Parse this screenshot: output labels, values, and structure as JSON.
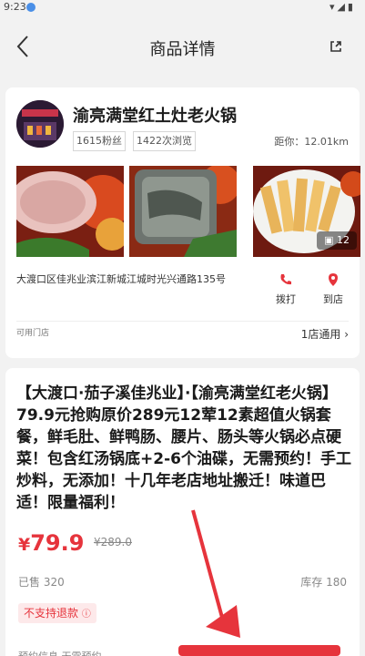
{
  "status_bar": {
    "time": "9:23",
    "right_icons": "▾◢▮"
  },
  "header": {
    "title": "商品详情"
  },
  "store": {
    "name": "渝亮满堂红土灶老火锅",
    "fans": "1615粉丝",
    "views": "1422次浏览",
    "distance": "距你：12.01km",
    "photo_count": "12",
    "address": "大渡口区佳兆业滨江新城江城时光兴通路135号",
    "call_label": "拨打",
    "go_label": "到店",
    "usable_label": "可用门店",
    "stores_link": "1店通用"
  },
  "product": {
    "title": "【大渡口·茄子溪佳兆业】·【渝亮满堂红老火锅】79.9元抢购原价289元12荤12素超值火锅套餐，鲜毛肚、鲜鸭肠、腰片、肠头等火锅必点硬菜！包含红汤锅底+2-6个油碟，无需预约！手工炒料，无添加！十几年老店地址搬迁！味道巴适！限量福利！",
    "price_symbol": "¥",
    "price": "79.9",
    "original_price": "¥289.0",
    "sold": "已售 320",
    "stock": "库存 180",
    "refund_badge": "不支持退款",
    "bottom_strip": "预约信息 无需预约"
  },
  "colors": {
    "accent": "#e6343c",
    "arrow": "#e6343c"
  }
}
